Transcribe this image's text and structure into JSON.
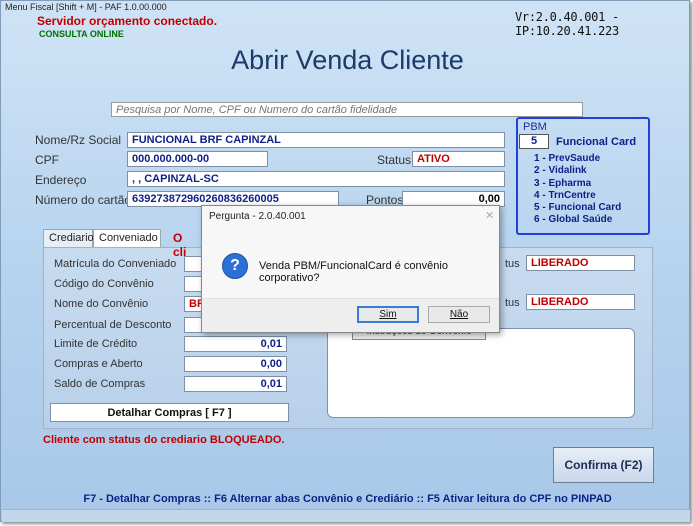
{
  "window": {
    "menu_title": "Menu Fiscal [Shift + M] - PAF 1.0.00.000",
    "server_status": "Servidor orçamento conectado.",
    "consulta_status": "CONSULTA ONLINE",
    "version": "Vr:2.0.40.001 - IP:10.20.41.223"
  },
  "header": {
    "title": "Abrir Venda Cliente"
  },
  "search": {
    "placeholder": "Pesquisa por Nome, CPF ou Numero do cartão fidelidade"
  },
  "client": {
    "name_label": "Nome/Rz Social",
    "name_value": "FUNCIONAL BRF CAPINZAL",
    "cpf_label": "CPF",
    "cpf_value": "000.000.000-00",
    "status_label": "Status",
    "status_value": "ATIVO",
    "address_label": "Endereço",
    "address_value": ", , CAPINZAL-SC",
    "card_label": "Número do cartão",
    "card_value": "639273872960260836260005",
    "points_label": "Pontos",
    "points_value": "0,00"
  },
  "pbm": {
    "label": "PBM",
    "selected_number": "5",
    "selected_name": "Funcional Card",
    "options": [
      "1 - PrevSaude",
      "2 - Vidalink",
      "3 - Epharma",
      "4 - TrnCentre",
      "5 - Funcional Card",
      "6 - Global Saúde"
    ]
  },
  "tabs": {
    "crediario": "Crediario",
    "conveniado": "Conveniado",
    "partial_red": "O cli"
  },
  "conveniado": {
    "matricula_label": "Matrícula do Conveniado",
    "codigo_label": "Código do Convênio",
    "nome_label": "Nome do Convênio",
    "nome_value": "BR",
    "percentual_label": "Percentual de Desconto",
    "limite_label": "Limite de Crédito",
    "limite_value": "0,01",
    "compras_label": "Compras e Aberto",
    "compras_value": "0,00",
    "saldo_label": "Saldo de Compras",
    "saldo_value": "0,01",
    "status1_label": "tus",
    "status1_value": "LIBERADO",
    "status2_label": "tus",
    "status2_value": "LIBERADO",
    "instrucoes_label": "Instruções do Convênio",
    "detalhar_button": "Detalhar Compras [ F7 ]"
  },
  "warning": "Cliente com status do crediario BLOQUEADO.",
  "confirm_button": "Confirma (F2)",
  "footer": "F7  - Detalhar Compras :: F6 Alternar abas Convênio e Crediário :: F5 Ativar leitura do CPF no PINPAD",
  "dialog": {
    "title": "Pergunta - 2.0.40.001",
    "close_glyph": "✕",
    "icon_glyph": "?",
    "message": "Venda PBM/FuncionalCard é convênio corporativo?",
    "yes_button": "Sim",
    "no_button": "Não"
  }
}
